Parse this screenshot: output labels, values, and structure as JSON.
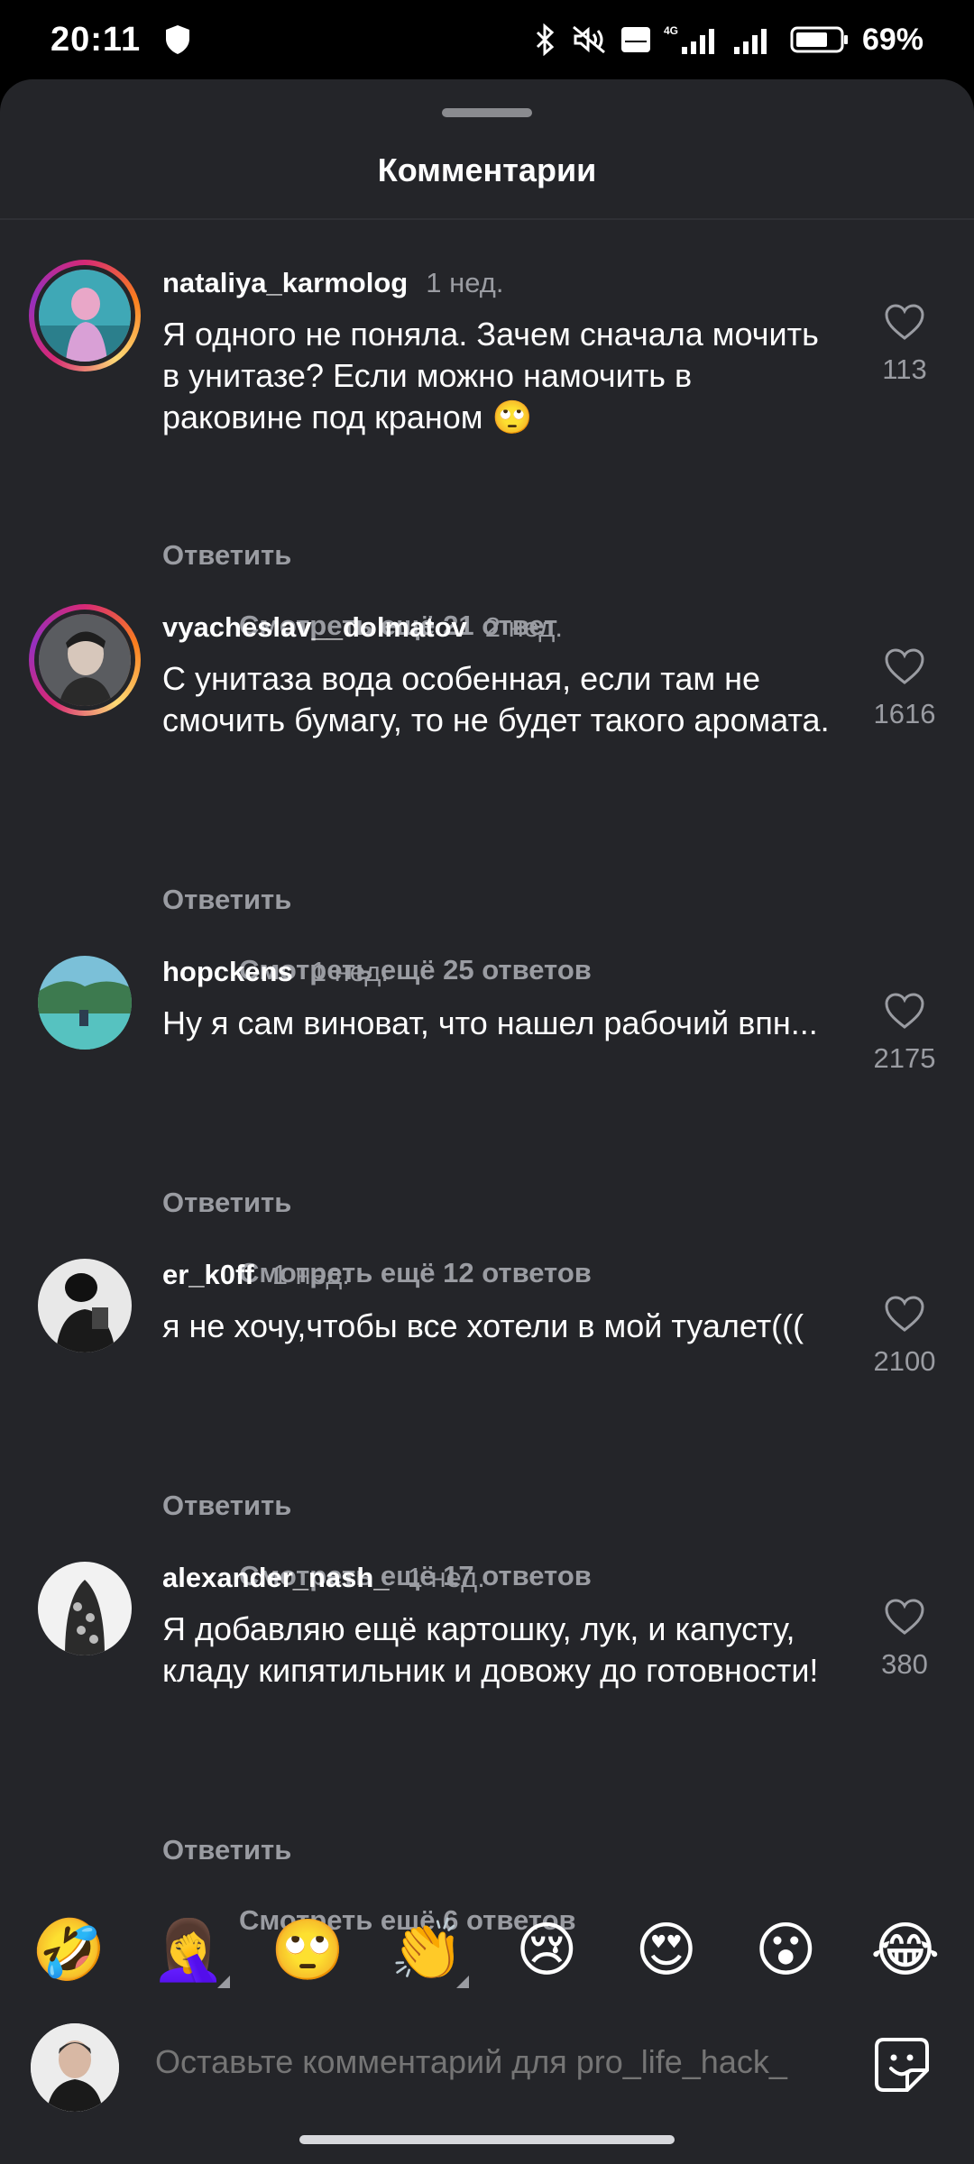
{
  "status_bar": {
    "time": "20:11",
    "battery": "69%",
    "network": "4G"
  },
  "sheet": {
    "title": "Комментарии"
  },
  "comments": [
    {
      "username": "nataliya_karmolog",
      "time": "1 нед.",
      "text": "Я одного не поняла. Зачем сначала мочить в унитазе? Если можно намочить в раковине под краном 🙄",
      "reply": "Ответить",
      "likes": "113",
      "more": "Смотреть ещё 21 ответ"
    },
    {
      "username": "vyacheslav__dolmatov",
      "time": "2 нед.",
      "text": "С унитаза вода особенная, если там не смочить бумагу, то не будет такого аромата.",
      "reply": "Ответить",
      "likes": "1616",
      "more": "Смотреть ещё 25 ответов"
    },
    {
      "username": "hopckens",
      "time": "1 нед.",
      "text": "Ну я сам виноват, что нашел рабочий впн...",
      "reply": "Ответить",
      "likes": "2175",
      "more": "Смотреть ещё 12 ответов"
    },
    {
      "username": "er_k0ff",
      "time": "1 нед.",
      "text": "я не хочу,чтобы все хотели в мой туалет(((",
      "reply": "Ответить",
      "likes": "2100",
      "more": "Смотреть ещё 17 ответов"
    },
    {
      "username": "alexander_nash_",
      "time": "1 нед.",
      "text": "Я добавляю ещё картошку, лук, и капусту, кладу кипятильник и довожу до готовности!",
      "reply": "Ответить",
      "likes": "380",
      "more": "Смотреть ещё 6 ответов"
    }
  ],
  "emoji_bar": [
    "🤣",
    "🤦‍♀️",
    "🙄",
    "👏",
    "😢",
    "😍",
    "😮",
    "😂"
  ],
  "composer": {
    "placeholder": "Оставьте комментарий для pro_life_hack_"
  },
  "colors": {
    "background": "#242529",
    "muted_text": "#9a9ca2",
    "story_ring": "#d62976"
  }
}
